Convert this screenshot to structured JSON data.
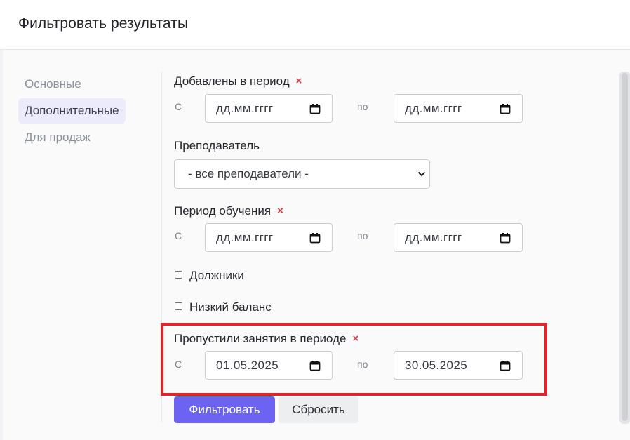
{
  "modal": {
    "title": "Фильтровать результаты"
  },
  "sidebar": {
    "items": [
      {
        "label": "Основные"
      },
      {
        "label": "Дополнительные",
        "active": true
      },
      {
        "label": "Для продаж"
      }
    ]
  },
  "filters": {
    "added_period": {
      "label": "Добавлены в период",
      "from_label": "С",
      "to_label": "по",
      "from_value": "дд.мм.гггг",
      "to_value": "дд.мм.гггг"
    },
    "teacher": {
      "label": "Преподаватель",
      "selected": "- все преподаватели -"
    },
    "study_period": {
      "label": "Период обучения",
      "from_label": "С",
      "to_label": "по",
      "from_value": "дд.мм.гггг",
      "to_value": "дд.мм.гггг"
    },
    "debtors": {
      "label": "Должники",
      "checked": false
    },
    "low_balance": {
      "label": "Низкий баланс",
      "checked": false
    },
    "missed_classes": {
      "label": "Пропустили занятия в периоде",
      "from_label": "С",
      "to_label": "по",
      "from_value": "01.05.2025",
      "to_value": "30.05.2025"
    }
  },
  "buttons": {
    "filter": "Фильтровать",
    "reset": "Сбросить"
  },
  "icons": {
    "remove": "×"
  },
  "colors": {
    "primary": "#6c63f2",
    "remove": "#dc3545",
    "highlight": "#e2232a",
    "active_tab_bg": "#ebebfb"
  }
}
